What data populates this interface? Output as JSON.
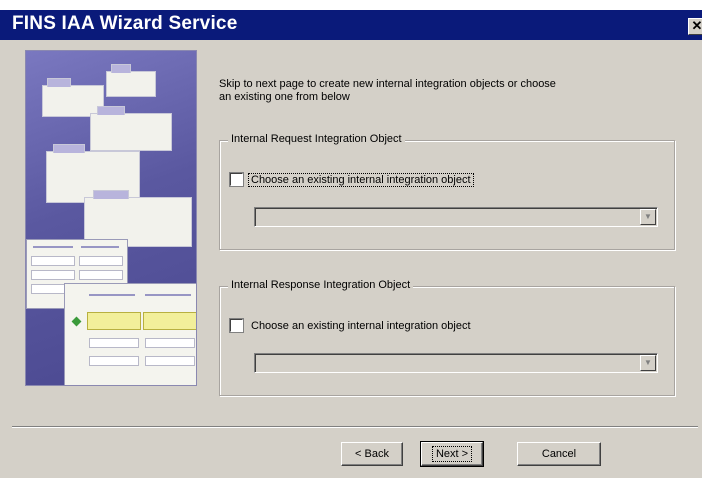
{
  "window": {
    "title": "FINS IAA Wizard Service",
    "close_glyph": "✕"
  },
  "intro": {
    "line1": "Skip to next page to create new internal integration objects or choose",
    "line2": "an existing one from below"
  },
  "request_group": {
    "label": "Internal Request Integration Object",
    "checkbox_label": "Choose an existing internal integration object",
    "checked": false,
    "combo_value": ""
  },
  "response_group": {
    "label": "Internal Response Integration Object",
    "checkbox_label": "Choose an existing internal integration object",
    "checked": false,
    "combo_value": ""
  },
  "buttons": {
    "back": "< Back",
    "next": "Next >",
    "cancel": "Cancel"
  },
  "icons": {
    "combo_arrow": "chevron-down-icon",
    "illustration": "folders-and-grid-illustration"
  },
  "colors": {
    "titlebar": "#0a1a7a",
    "dialog_bg": "#d4d0c8",
    "illustration_bg": "#5a58a0"
  }
}
